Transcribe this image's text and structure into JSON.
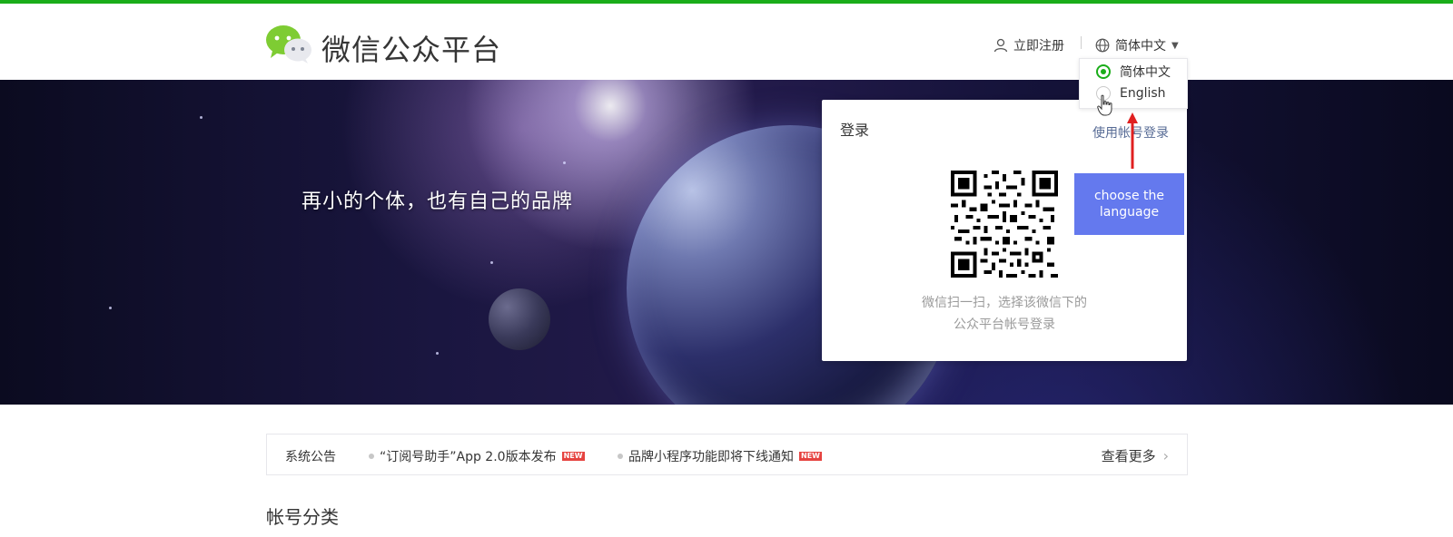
{
  "header": {
    "brand": "微信公众平台",
    "register": "立即注册",
    "language_current": "简体中文"
  },
  "language_menu": {
    "options": [
      {
        "label": "简体中文",
        "selected": true
      },
      {
        "label": "English",
        "selected": false
      }
    ]
  },
  "banner": {
    "slogan": "再小的个体，也有自己的品牌"
  },
  "login": {
    "title": "登录",
    "account_login_link": "使用帐号登录",
    "qr_hint_line1": "微信扫一扫，选择该微信下的",
    "qr_hint_line2": "公众平台帐号登录"
  },
  "tooltip": {
    "text": "choose the language"
  },
  "notices": {
    "label": "系统公告",
    "items": [
      {
        "text": "“订阅号助手”App 2.0版本发布",
        "badge": "NEW"
      },
      {
        "text": "品牌小程序功能即将下线通知",
        "badge": "NEW"
      }
    ],
    "more": "查看更多"
  },
  "section": {
    "title": "帐号分类"
  },
  "colors": {
    "brand_green": "#1AAD19",
    "link_blue": "#576b95",
    "tooltip_blue": "#6479ee",
    "arrow_red": "#e02020"
  }
}
